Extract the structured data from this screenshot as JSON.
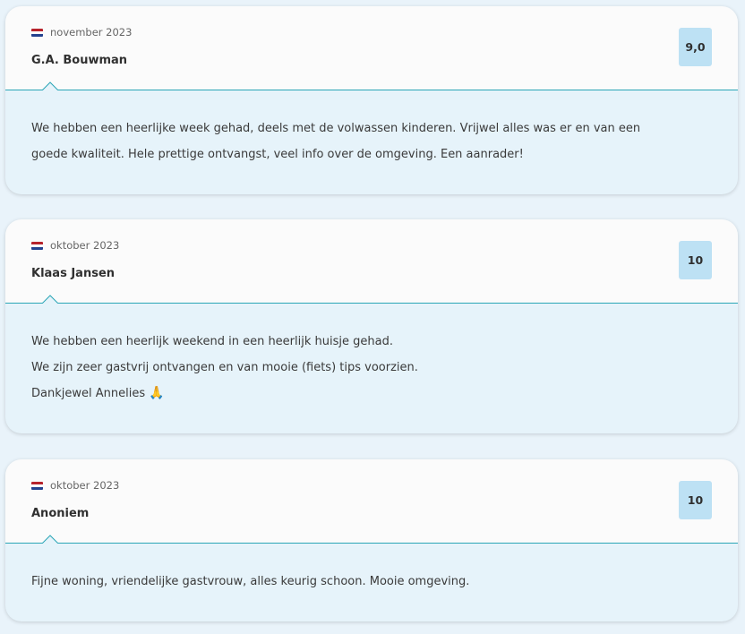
{
  "reviews": [
    {
      "date": "november 2023",
      "name": "G.A. Bouwman",
      "score": "9,0",
      "body": [
        "We hebben een heerlijke week gehad, deels met de volwassen kinderen. Vrijwel alles was er en van een",
        "goede kwaliteit. Hele prettige ontvangst, veel info over de omgeving. Een aanrader!"
      ]
    },
    {
      "date": "oktober 2023",
      "name": "Klaas Jansen",
      "score": "10",
      "body": [
        "We hebben een heerlijk weekend in een heerlijk huisje gehad.",
        "We zijn zeer gastvrij ontvangen en van mooie (fiets) tips voorzien.",
        "Dankjewel Annelies"
      ],
      "emoji": "🙏"
    },
    {
      "date": "oktober 2023",
      "name": "Anoniem",
      "score": "10",
      "body": [
        "Fijne woning, vriendelijke gastvrouw, alles keurig schoon. Mooie omgeving."
      ]
    }
  ]
}
